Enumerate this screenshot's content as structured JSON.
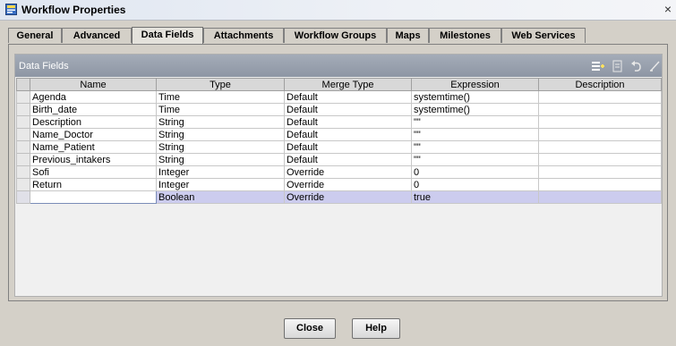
{
  "window": {
    "title": "Workflow Properties",
    "close_glyph": "×"
  },
  "tabs": [
    {
      "label": "General"
    },
    {
      "label": "Advanced"
    },
    {
      "label": "Data Fields",
      "active": true
    },
    {
      "label": "Attachments"
    },
    {
      "label": "Workflow Groups"
    },
    {
      "label": "Maps"
    },
    {
      "label": "Milestones"
    },
    {
      "label": "Web Services"
    }
  ],
  "section": {
    "title": "Data Fields",
    "toolbar_icons": [
      "add-field-icon",
      "edit-field-icon",
      "undo-icon",
      "delete-icon"
    ]
  },
  "table": {
    "columns": [
      "Name",
      "Type",
      "Merge Type",
      "Expression",
      "Description"
    ],
    "rows": [
      [
        "Agenda",
        "Time",
        "Default",
        "systemtime()",
        ""
      ],
      [
        "Birth_date",
        "Time",
        "Default",
        "systemtime()",
        ""
      ],
      [
        "Description",
        "String",
        "Default",
        "\"\"",
        ""
      ],
      [
        "Name_Doctor",
        "String",
        "Default",
        "\"\"",
        ""
      ],
      [
        "Name_Patient",
        "String",
        "Default",
        "\"\"",
        ""
      ],
      [
        "Previous_intakers",
        "String",
        "Default",
        "\"\"",
        ""
      ],
      [
        "Sofi",
        "Integer",
        "Override",
        "0",
        ""
      ],
      [
        "Return",
        "Integer",
        "Override",
        "0",
        ""
      ],
      [
        "",
        "Boolean",
        "Override",
        "true",
        ""
      ]
    ]
  },
  "buttons": {
    "close": "Close",
    "help": "Help"
  },
  "colors": {
    "selected_row": "#ccccee",
    "section_header": "#9aa2b0"
  }
}
